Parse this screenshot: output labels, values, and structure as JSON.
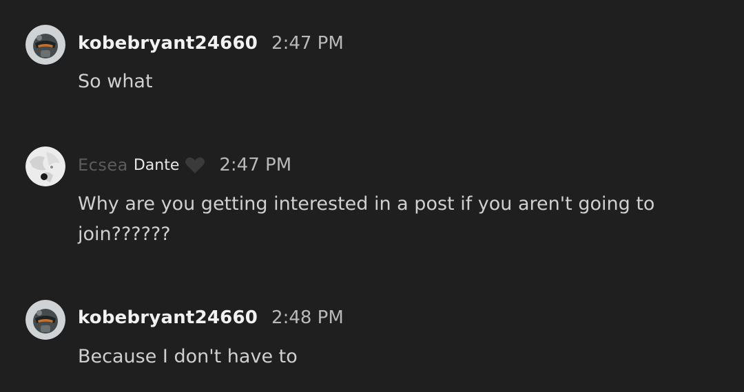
{
  "messages": [
    {
      "author": "kobebryant24660",
      "time": "2:47 PM",
      "text": "So what",
      "avatar_icon": "armored-helmet-avatar"
    },
    {
      "author_part1": "Ecsea",
      "author_part2": "Dante",
      "author_emoji_icon": "black-heart-icon",
      "time": "2:47 PM",
      "text": "Why are you getting interested in a post if you aren't going to join??????",
      "avatar_icon": "white-character-avatar"
    },
    {
      "author": "kobebryant24660",
      "time": "2:48 PM",
      "text": "Because I don't have to",
      "avatar_icon": "armored-helmet-avatar"
    }
  ],
  "colors": {
    "background": "#1f1f1f",
    "username": "#f2f2f2",
    "timestamp": "#b9b9b9",
    "message_text": "#d0d0d0",
    "dim_name": "#5c5c5c",
    "heart": "#3a3a3a"
  }
}
